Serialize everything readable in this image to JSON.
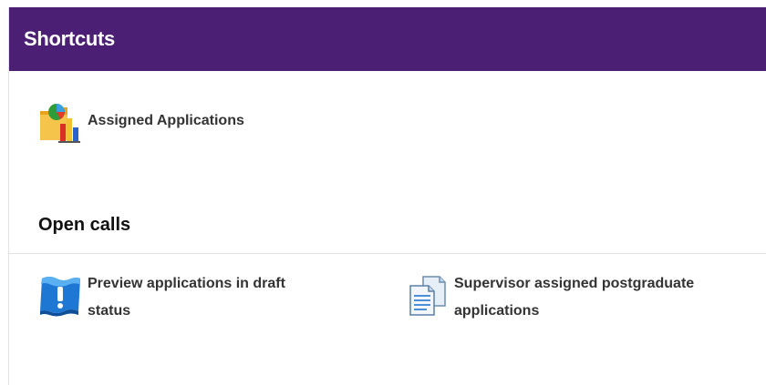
{
  "header": {
    "title": "Shortcuts"
  },
  "shortcuts": [
    {
      "label": "Assigned Applications",
      "icon": "applications-chart-icon"
    }
  ],
  "open_calls": {
    "title": "Open calls",
    "items": [
      {
        "label": "Preview applications in draft status",
        "icon": "draft-notice-icon"
      },
      {
        "label": "Supervisor assigned postgraduate applications",
        "icon": "documents-icon"
      }
    ]
  },
  "colors": {
    "header_bg": "#4b1f73",
    "header_text": "#ffffff",
    "label_text": "#333333"
  }
}
